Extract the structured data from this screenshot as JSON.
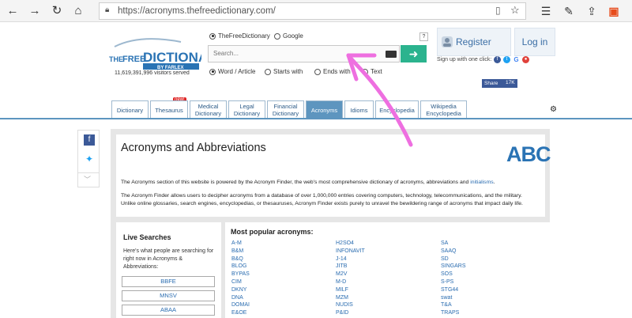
{
  "browser": {
    "url": "https://acronyms.thefreedictionary.com/",
    "icons": [
      "back-icon",
      "forward-icon",
      "refresh-icon",
      "home-icon",
      "lock-icon",
      "reading-view-icon",
      "favorite-star-icon",
      "favorites-hub-icon",
      "pen-icon",
      "share-icon",
      "office-icon"
    ]
  },
  "header": {
    "logo_line1": "THE",
    "logo_line2": "FREE",
    "logo_line3": "DICTIONARY",
    "logo_byline": "BY FARLEX",
    "visitors": "11,619,391,996 visitors served",
    "source_options": [
      "TheFreeDictionary",
      "Google"
    ],
    "search_placeholder": "Search...",
    "search_modes": [
      "Word / Article",
      "Starts with",
      "Ends with",
      "Text"
    ],
    "help": "?",
    "register": "Register",
    "login": "Log in",
    "signup_text": "Sign up with one click:",
    "fb_share": "Share",
    "fb_count": "17K"
  },
  "tabs": [
    {
      "label": "Dictionary"
    },
    {
      "label": "Thesaurus"
    },
    {
      "label": "Medical\nDictionary"
    },
    {
      "label": "Legal\nDictionary"
    },
    {
      "label": "Financial\nDictionary"
    },
    {
      "label": "Acronyms"
    },
    {
      "label": "Idioms"
    },
    {
      "label": "Encyclopedia"
    },
    {
      "label": "Wikipedia\nEncyclopedia"
    }
  ],
  "new_badge": "new!",
  "intro": {
    "title": "Acronyms and Abbreviations",
    "abc": "ABC",
    "para1": "The Acronyms section of this website is powered by the Acronym Finder, the web's most comprehensive dictionary of acronyms, abbreviations and ",
    "para1_link": "initialisms",
    "para1_end": ".",
    "para2_line1": "The Acronym Finder allows users to decipher acronyms from a database of over 1,000,000 entries covering computers, technology, telecommunications, and the military.",
    "para2_line2": "Unlike online glossaries, search engines, encyclopedias, or thesauruses, Acronym Finder exists purely to unravel the bewildering range of acronyms that impact daily life."
  },
  "live": {
    "title": "Live Searches",
    "desc": "Here's what people are searching for right now in Acronyms & Abbreviations:",
    "items": [
      "BBFE",
      "MNSV",
      "ABAA"
    ]
  },
  "popular": {
    "title": "Most popular acronyms:",
    "col1": [
      "A-M",
      "B&M",
      "B&Q",
      "BLOG",
      "BYPAS",
      "CIM",
      "DKNY",
      "DNA",
      "DOMAI",
      "E&OE"
    ],
    "col2": [
      "H2SO4",
      "INFONAVIT",
      "J-14",
      "JITB",
      "M2V",
      "M-D",
      "MILF",
      "MZM",
      "NUDIS",
      "P&ID"
    ],
    "col3": [
      "SA",
      "SAAQ",
      "SD",
      "SINGARS",
      "SOS",
      "S-PS",
      "STG44",
      "swat",
      "T&A",
      "TRAPS"
    ]
  },
  "colors": {
    "accent": "#5d95bf",
    "link": "#2a6cb0",
    "go_button": "#2bb38e",
    "annotation": "#ee6fe0"
  }
}
